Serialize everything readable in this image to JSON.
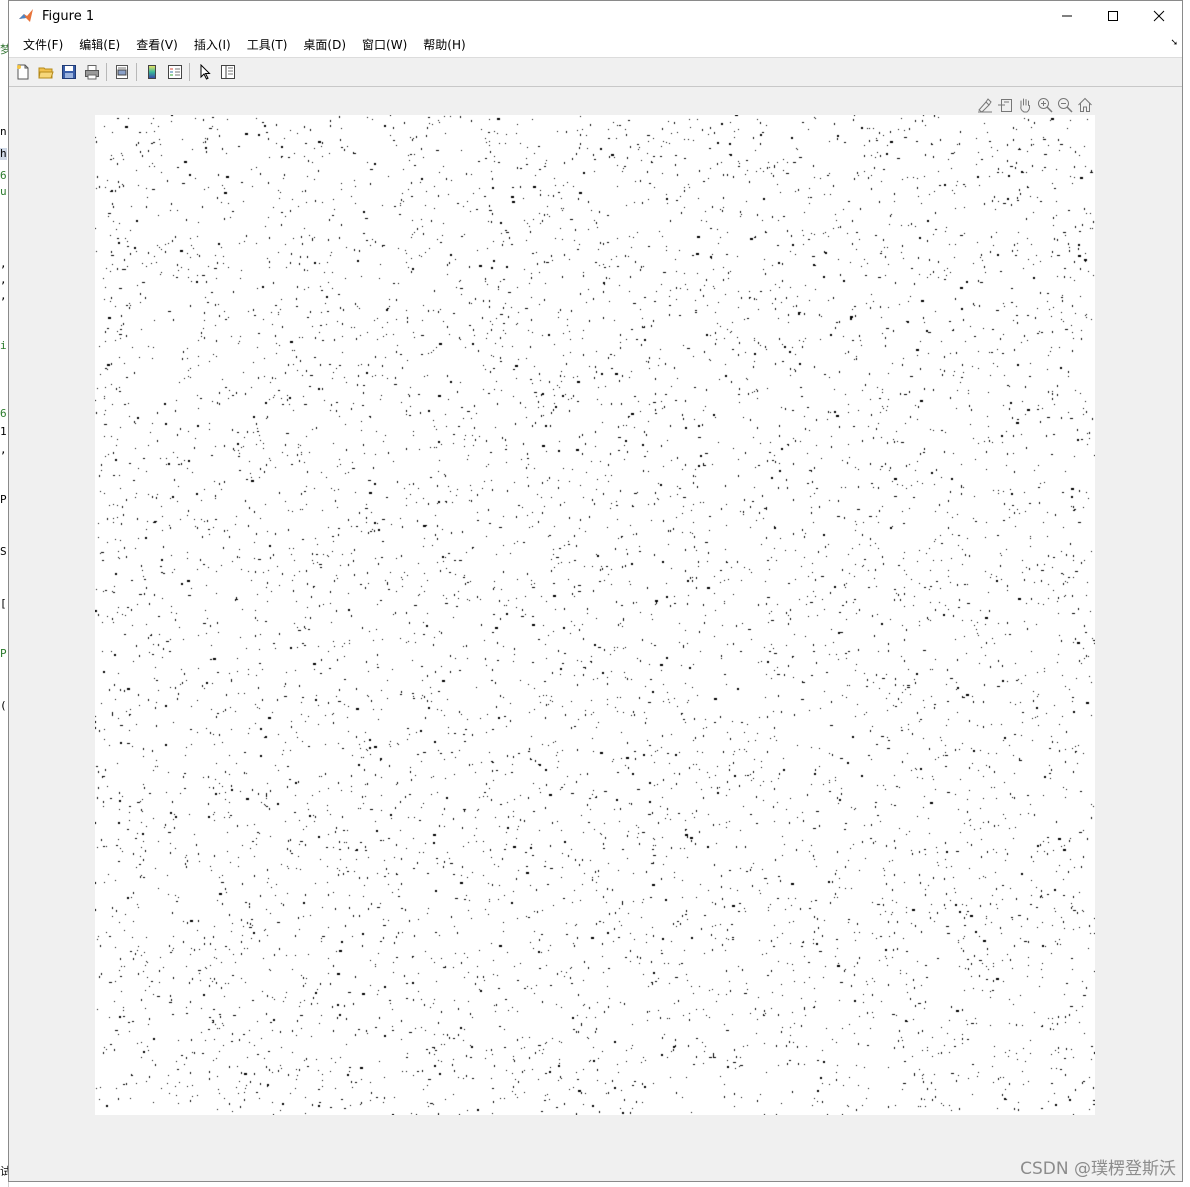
{
  "window": {
    "title": "Figure 1"
  },
  "menu": [
    {
      "label": "文件(F)"
    },
    {
      "label": "编辑(E)"
    },
    {
      "label": "查看(V)"
    },
    {
      "label": "插入(I)"
    },
    {
      "label": "工具(T)"
    },
    {
      "label": "桌面(D)"
    },
    {
      "label": "窗口(W)"
    },
    {
      "label": "帮助(H)"
    }
  ],
  "toolbar_icons": [
    "new-figure-icon",
    "open-file-icon",
    "save-icon",
    "print-icon",
    "print-preview-icon",
    "colorbar-icon",
    "legend-icon",
    "select-arrow-icon",
    "property-inspector-icon"
  ],
  "axes_toolbar_icons": [
    "brush-icon",
    "data-tips-icon",
    "pan-hand-icon",
    "zoom-in-icon",
    "zoom-out-icon",
    "home-icon"
  ],
  "editor_fragments": [
    "梦",
    "n",
    "h",
    "6",
    "u",
    ",",
    ",",
    ",",
    "i",
    "6",
    "1",
    ",",
    "P",
    "S",
    "[",
    "P",
    "(",
    "试"
  ],
  "image": {
    "description_type": "binary-noise",
    "foreground": "#000000",
    "background": "#ffffff"
  },
  "watermark": "CSDN @璞楞登斯沃"
}
